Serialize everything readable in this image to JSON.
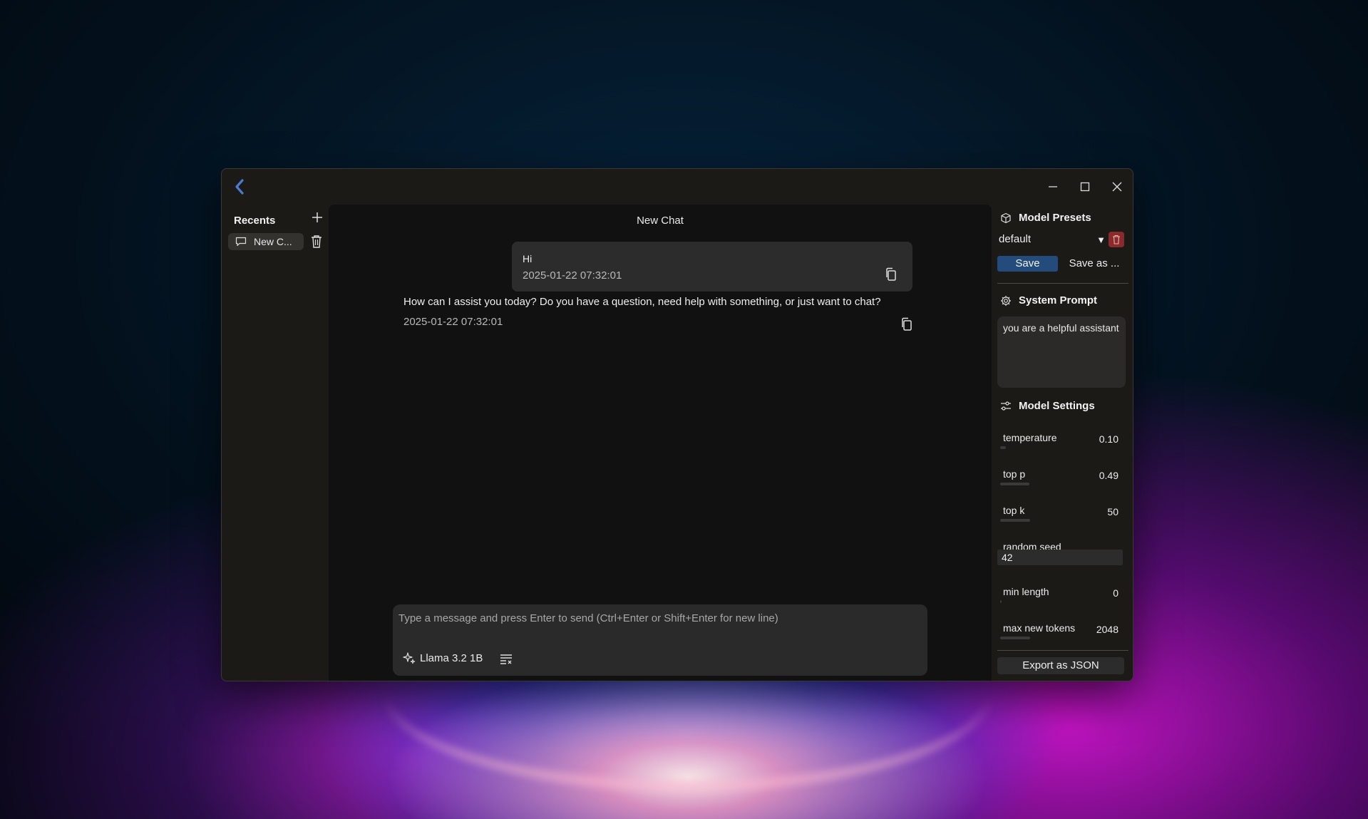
{
  "window": {
    "title": ""
  },
  "sidebar": {
    "title": "Recents",
    "items": [
      {
        "label": "New C..."
      }
    ]
  },
  "chat": {
    "title": "New Chat",
    "messages": [
      {
        "role": "user",
        "text": "Hi",
        "time": "2025-01-22 07:32:01"
      },
      {
        "role": "assistant",
        "text": "How can I assist you today? Do you have a question, need help with something, or just want to chat?",
        "time": "2025-01-22 07:32:01"
      }
    ],
    "composer": {
      "placeholder": "Type a message and press Enter to send (Ctrl+Enter or Shift+Enter for new line)",
      "model": "Llama 3.2 1B"
    }
  },
  "panel": {
    "presets": {
      "title": "Model Presets",
      "selected": "default",
      "save_label": "Save",
      "save_as_label": "Save as ..."
    },
    "system_prompt": {
      "title": "System Prompt",
      "value": "you are a helpful assistant"
    },
    "settings": {
      "title": "Model Settings",
      "temperature": {
        "label": "temperature",
        "value": "0.10",
        "level": 0.1
      },
      "top_p": {
        "label": "top p",
        "value": "0.49",
        "level": 0.49
      },
      "top_k": {
        "label": "top k",
        "value": "50",
        "level": 0.5
      },
      "random_seed": {
        "label": "random seed",
        "value": "42"
      },
      "min_length": {
        "label": "min length",
        "value": "0",
        "level": 0.0
      },
      "max_new_tokens": {
        "label": "max new tokens",
        "value": "2048",
        "level": 0.5
      }
    },
    "export_label": "Export as JSON"
  },
  "colors": {
    "accent": "#4a7bd0",
    "save_button": "#234b7c",
    "delete_button": "#8a2b2b"
  }
}
